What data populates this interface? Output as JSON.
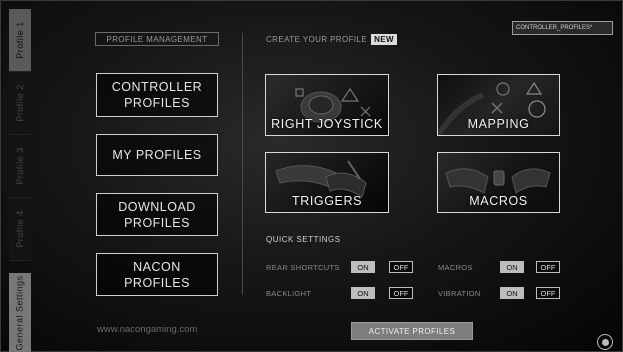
{
  "tabs": [
    {
      "label": "Profile 1",
      "active": true
    },
    {
      "label": "Profile 2",
      "active": false
    },
    {
      "label": "Profile 3",
      "active": false
    },
    {
      "label": "Profile 4",
      "active": false
    },
    {
      "label": "General Settings",
      "active": false
    }
  ],
  "left": {
    "section_label": "PROFILE MANAGEMENT",
    "buttons": [
      {
        "label": "CONTROLLER\nPROFILES"
      },
      {
        "label": "MY PROFILES"
      },
      {
        "label": "DOWNLOAD\nPROFILES"
      },
      {
        "label": "NACON\nPROFILES"
      }
    ],
    "website": "www.nacongaming.com"
  },
  "right": {
    "create_label": "CREATE YOUR PROFILE",
    "new_badge": "NEW",
    "profile_select": "CONTROLLER_PROFILES*",
    "tiles": [
      {
        "label": "RIGHT JOYSTICK",
        "image": "joystick-closeup"
      },
      {
        "label": "MAPPING",
        "image": "face-buttons-closeup"
      },
      {
        "label": "TRIGGERS",
        "image": "triggers-closeup"
      },
      {
        "label": "MACROS",
        "image": "rear-buttons-closeup"
      }
    ],
    "quick_settings": {
      "title": "QUICK SETTINGS",
      "rows": [
        {
          "label": "REAR SHORTCUTS",
          "on": "ON",
          "off": "OFF"
        },
        {
          "label": "MACROS",
          "on": "ON",
          "off": "OFF"
        },
        {
          "label": "BACKLIGHT",
          "on": "ON",
          "off": "OFF"
        },
        {
          "label": "VIBRATION",
          "on": "ON",
          "off": "OFF"
        }
      ]
    },
    "activate_label": "ACTIVATE PROFILES"
  },
  "footer": {
    "home_icon": "home-circle-icon"
  }
}
